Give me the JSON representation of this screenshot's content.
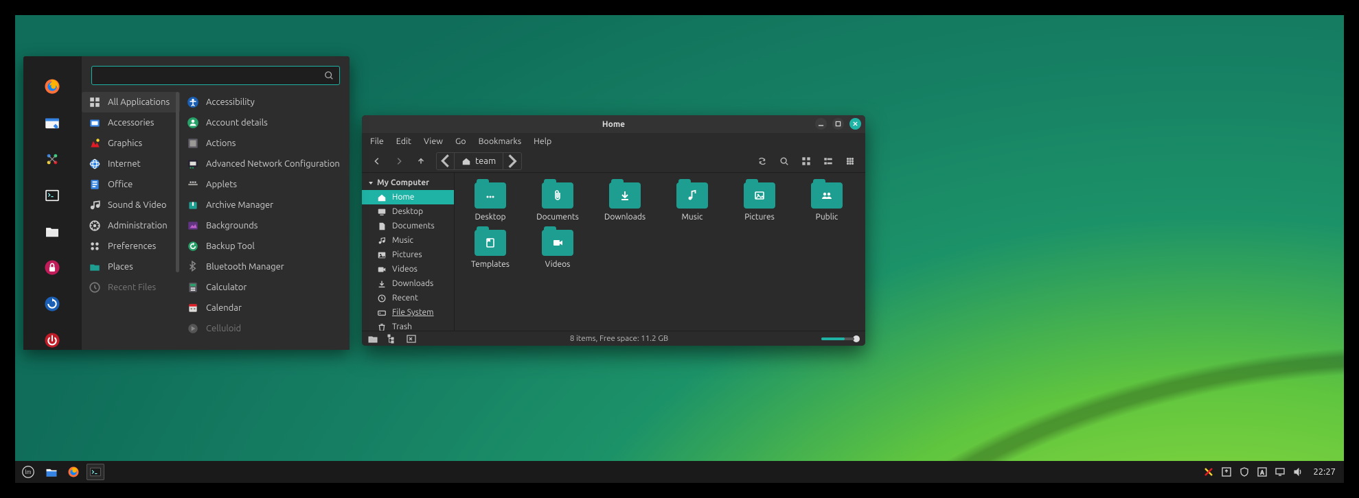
{
  "colors": {
    "accent": "#1fb3a6",
    "folder": "#1d9e91"
  },
  "menu": {
    "search_placeholder": "",
    "categories": [
      {
        "label": "All Applications",
        "icon": "grid",
        "selected": true
      },
      {
        "label": "Accessories",
        "icon": "accessories"
      },
      {
        "label": "Graphics",
        "icon": "graphics"
      },
      {
        "label": "Internet",
        "icon": "internet"
      },
      {
        "label": "Office",
        "icon": "office"
      },
      {
        "label": "Sound & Video",
        "icon": "media"
      },
      {
        "label": "Administration",
        "icon": "admin"
      },
      {
        "label": "Preferences",
        "icon": "prefs"
      },
      {
        "label": "Places",
        "icon": "places"
      },
      {
        "label": "Recent Files",
        "icon": "recent",
        "dim": true
      }
    ],
    "apps": [
      {
        "label": "Accessibility",
        "icon": "accessibility"
      },
      {
        "label": "Account details",
        "icon": "account"
      },
      {
        "label": "Actions",
        "icon": "actions"
      },
      {
        "label": "Advanced Network Configuration",
        "icon": "network"
      },
      {
        "label": "Applets",
        "icon": "applets"
      },
      {
        "label": "Archive Manager",
        "icon": "archive"
      },
      {
        "label": "Backgrounds",
        "icon": "backgrounds"
      },
      {
        "label": "Backup Tool",
        "icon": "backup"
      },
      {
        "label": "Bluetooth Manager",
        "icon": "bluetooth"
      },
      {
        "label": "Calculator",
        "icon": "calculator"
      },
      {
        "label": "Calendar",
        "icon": "calendar"
      },
      {
        "label": "Celluloid",
        "icon": "celluloid",
        "dim": true
      }
    ],
    "favorites": [
      "firefox",
      "software",
      "settings",
      "terminal",
      "files",
      "lock",
      "updates",
      "power"
    ]
  },
  "fm": {
    "title": "Home",
    "menubar": [
      "File",
      "Edit",
      "View",
      "Go",
      "Bookmarks",
      "Help"
    ],
    "path_label": "team",
    "sidebar": {
      "heading": "My Computer",
      "items": [
        {
          "label": "Home",
          "icon": "home",
          "selected": true
        },
        {
          "label": "Desktop",
          "icon": "desktop"
        },
        {
          "label": "Documents",
          "icon": "doc"
        },
        {
          "label": "Music",
          "icon": "music"
        },
        {
          "label": "Pictures",
          "icon": "pic"
        },
        {
          "label": "Videos",
          "icon": "video"
        },
        {
          "label": "Downloads",
          "icon": "download"
        },
        {
          "label": "Recent",
          "icon": "recent"
        },
        {
          "label": "File System",
          "icon": "fs",
          "underlined": true
        },
        {
          "label": "Trash",
          "icon": "trash"
        }
      ]
    },
    "folders": [
      {
        "label": "Desktop",
        "glyph": "dots"
      },
      {
        "label": "Documents",
        "glyph": "clip"
      },
      {
        "label": "Downloads",
        "glyph": "download"
      },
      {
        "label": "Music",
        "glyph": "music"
      },
      {
        "label": "Pictures",
        "glyph": "image"
      },
      {
        "label": "Public",
        "glyph": "people"
      },
      {
        "label": "Templates",
        "glyph": "template"
      },
      {
        "label": "Videos",
        "glyph": "video"
      }
    ],
    "status": "8 items, Free space: 11.2 GB"
  },
  "panel": {
    "clock": "22:27",
    "tray": [
      "xorg",
      "tray1",
      "shield",
      "keyboard",
      "display",
      "volume"
    ]
  }
}
